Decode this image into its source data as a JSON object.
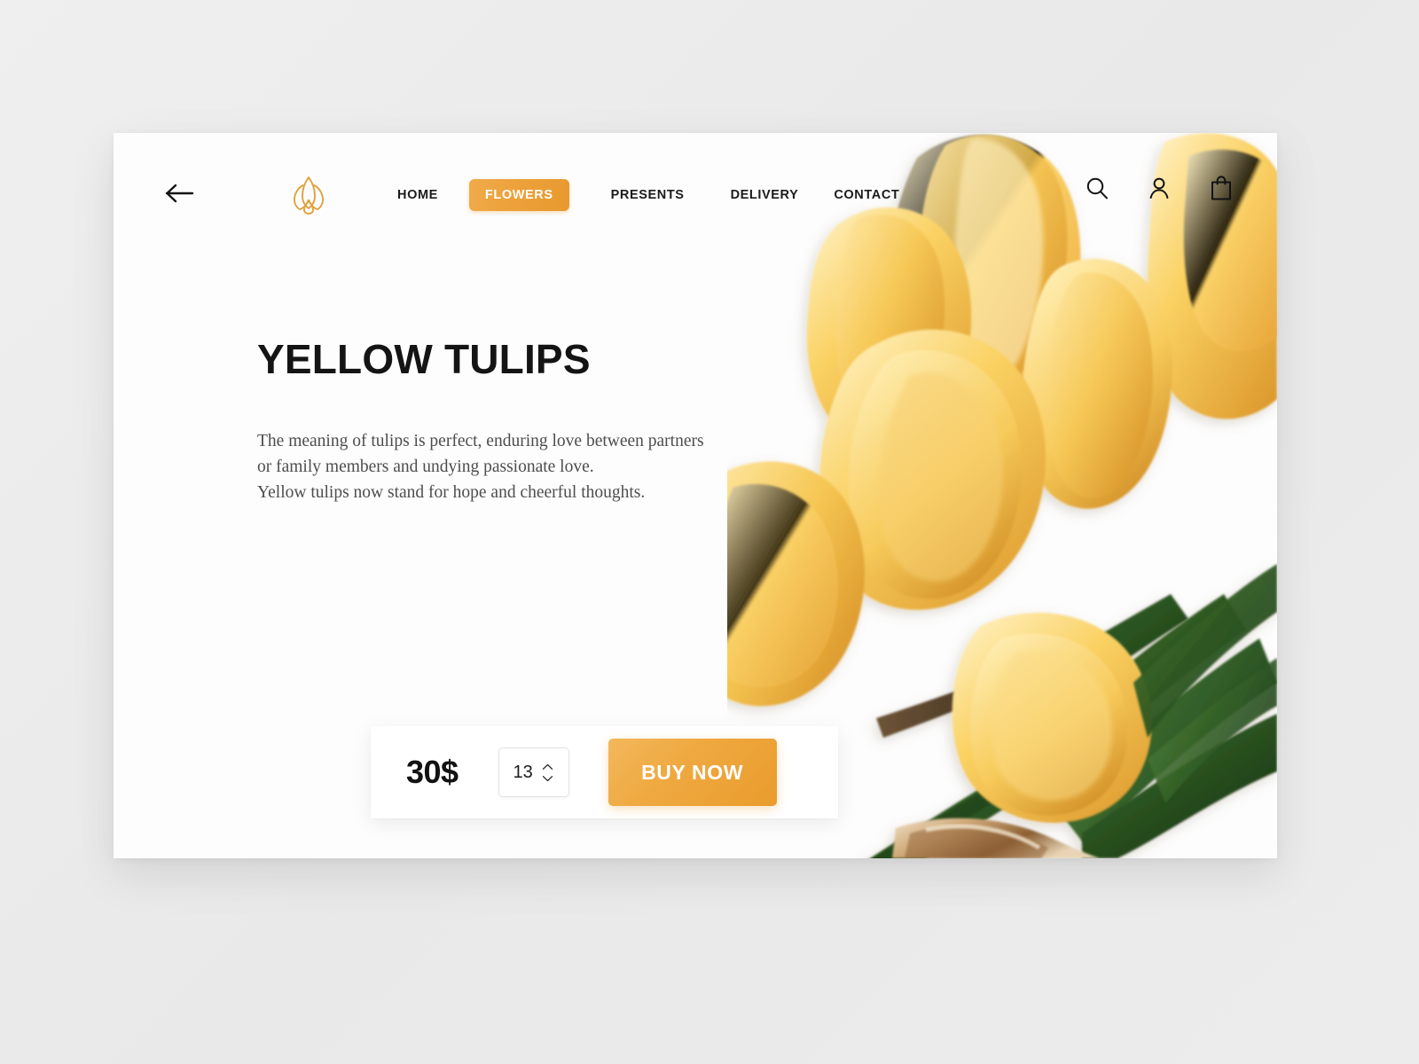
{
  "header": {
    "back_icon": "arrow-left-icon",
    "logo_icon": "lotus-flower-logo",
    "nav": [
      {
        "label": "HOME",
        "active": false
      },
      {
        "label": "FLOWERS",
        "active": true
      },
      {
        "label": "PRESENTS",
        "active": false
      },
      {
        "label": "DELIVERY",
        "active": false
      },
      {
        "label": "CONTACT",
        "active": false
      }
    ],
    "icons": [
      {
        "name": "search-icon"
      },
      {
        "name": "user-account-icon"
      },
      {
        "name": "shopping-bag-icon"
      }
    ]
  },
  "product": {
    "title": "YELLOW TULIPS",
    "description": "The meaning of tulips is perfect, enduring love between partners\nor family members and undying passionate love.\nYellow tulips now stand for hope and cheerful thoughts.",
    "price": "30$",
    "quantity": "13",
    "buy_label": "BUY NOW",
    "image_alt": "yellow-tulips-bouquet"
  },
  "actions": {
    "share_icon": "share-icon",
    "favorite_icon": "heart-icon"
  },
  "colors": {
    "accent_light": "#f3b85c",
    "accent": "#efa941",
    "accent_dark": "#e7992e",
    "page_bg": "#ededed",
    "card_bg": "#fdfdfd",
    "text_dark": "#141414",
    "text_body": "#4d4d4d"
  }
}
